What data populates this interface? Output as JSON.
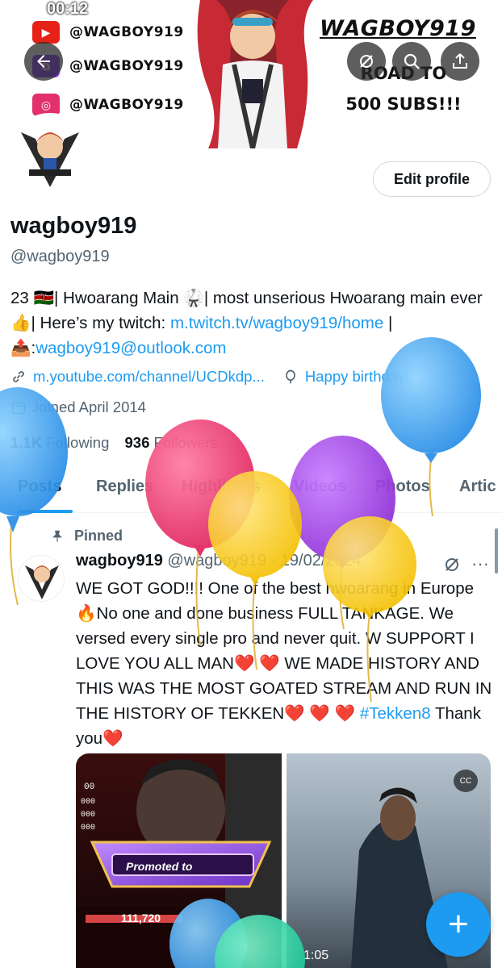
{
  "status_bar": {
    "time": "00:12"
  },
  "banner": {
    "socials": [
      {
        "icon": "youtube-icon",
        "handle": "@WAGBOY919"
      },
      {
        "icon": "twitch-icon",
        "handle": "@WAGBOY919"
      },
      {
        "icon": "instagram-icon",
        "handle": "@WAGBOY919"
      }
    ],
    "title": "WAGBOY919",
    "subtitle_line1": "ROAD TO",
    "subtitle_line2": "500 SUBS!!!"
  },
  "top_actions": [
    "back-icon",
    "grok-icon",
    "search-icon",
    "share-icon"
  ],
  "profile": {
    "edit_label": "Edit profile",
    "display_name": "wagboy919",
    "handle": "@wagboy919",
    "bio_part1": "23 🇰🇪| Hwoarang Main 🥋| most unserious Hwoarang main ever👍| Here’s my twitch: ",
    "bio_link": "m.twitch.tv/wagboy919/home",
    "bio_part2": " | 📤:",
    "bio_email": "wagboy919@outlook.com",
    "website": "m.youtube.com/channel/UCDkdp...",
    "birthday": "Happy birthday!",
    "joined": "Joined April 2014",
    "following_count": "1.1K",
    "following_label": "Following",
    "followers_count": "936",
    "followers_label": "Followers"
  },
  "tabs": [
    "Posts",
    "Replies",
    "Highlights",
    "Videos",
    "Photos",
    "Artic"
  ],
  "post": {
    "pinned_label": "Pinned",
    "name": "wagboy919",
    "meta": "@wagboy919 · 19/02/2024",
    "more": "···",
    "text": "WE GOT GOD!!!! One of the best hwoarang in Europe 🔥No one and done business FULL TANKAGE. We versed every single pro and never quit.  W SUPPORT I LOVE YOU ALL MAN❤️ ❤️ WE MADE HISTORY AND THIS WAS THE MOST GOATED STREAM AND RUN IN THE HISTORY OF TEKKEN❤️ ❤️ ❤️ ",
    "hashtag": "#Tekken8",
    "text_end": "  Thank you❤️",
    "media_1_caption": "Promoted to",
    "media_1_count": "111,720",
    "media_2_time": "1:05",
    "cc_label": "CC"
  },
  "fab_label": "+",
  "colors": {
    "accent": "#1d9bf0",
    "text": "#0f1419",
    "muted": "#536471"
  }
}
